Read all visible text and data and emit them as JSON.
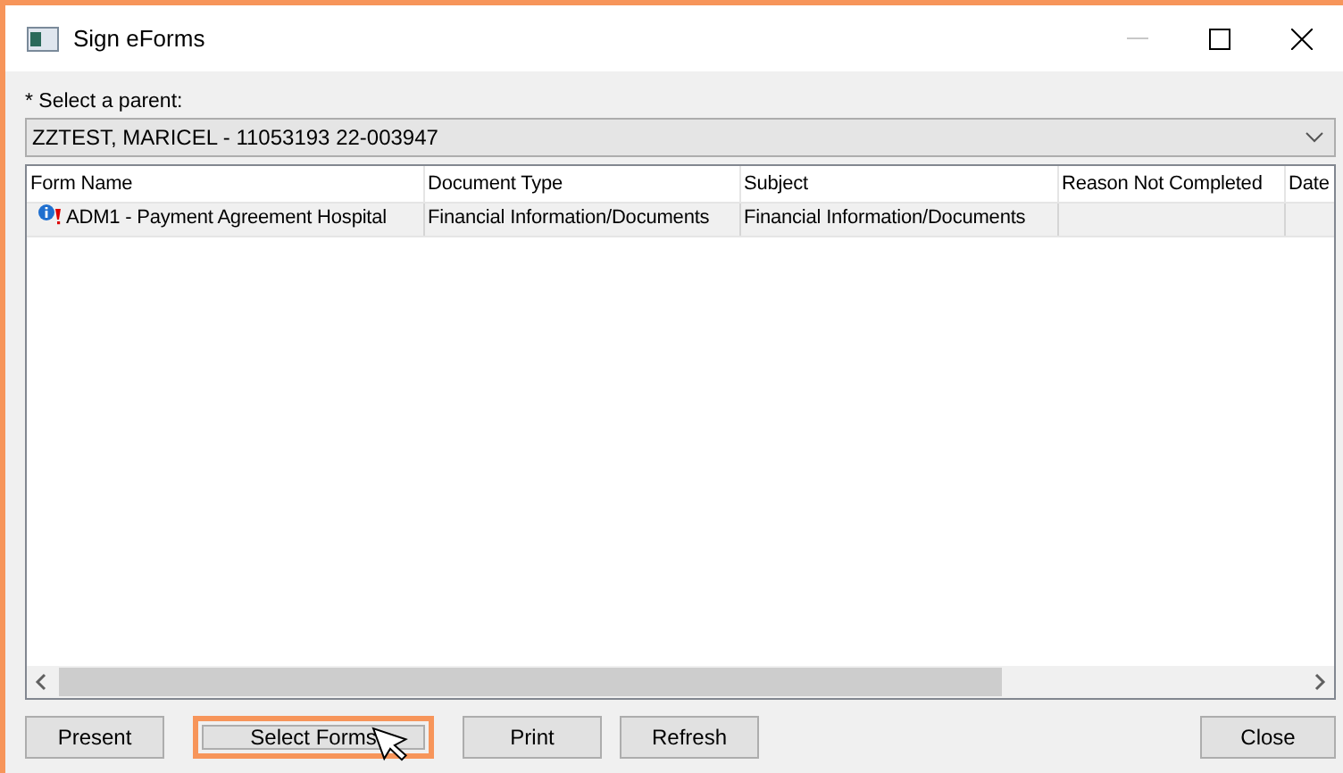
{
  "window": {
    "title": "Sign eForms"
  },
  "parent_select": {
    "label": "* Select a parent:",
    "value": "ZZTEST, MARICEL - 11053193 22-003947"
  },
  "table": {
    "columns": [
      "Form Name",
      "Document Type",
      "Subject",
      "Reason Not Completed",
      "Date"
    ],
    "rows": [
      {
        "selected": true,
        "cells": [
          "ADM1 - Payment Agreement Hospital",
          "Financial Information/Documents",
          "Financial Information/Documents",
          "",
          ""
        ]
      }
    ]
  },
  "buttons": [
    {
      "label": "Present",
      "highlighted": false
    },
    {
      "label": "Select Forms",
      "highlighted": true
    },
    {
      "label": "Print",
      "highlighted": false
    },
    {
      "label": "Refresh",
      "highlighted": false
    },
    {
      "label": "Close",
      "highlighted": false
    }
  ]
}
